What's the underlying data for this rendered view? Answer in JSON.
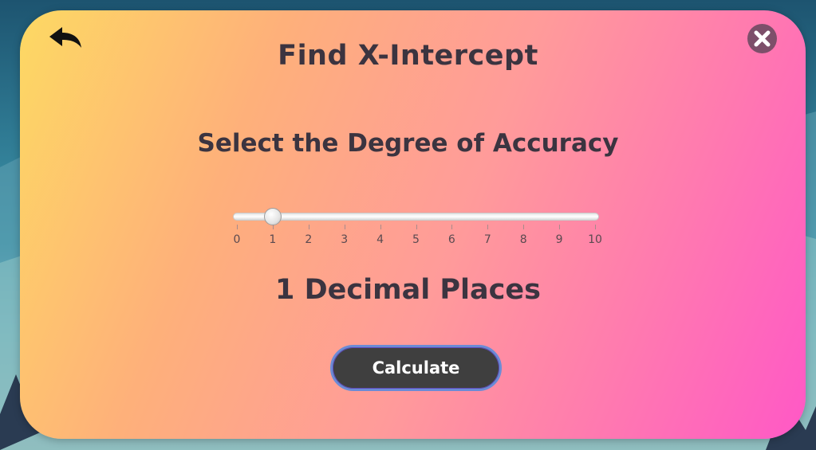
{
  "dialog": {
    "title": "Find X-Intercept",
    "subtitle": "Select the Degree of Accuracy",
    "value_text": "1 Decimal Places",
    "calculate_label": "Calculate"
  },
  "slider": {
    "min": 0,
    "max": 10,
    "value": 1,
    "tick_labels": [
      "0",
      "1",
      "2",
      "3",
      "4",
      "5",
      "6",
      "7",
      "8",
      "9",
      "10"
    ]
  },
  "icons": {
    "back": "back-arrow-icon",
    "close": "close-icon"
  },
  "colors": {
    "panel_gradient_start": "#fdd963",
    "panel_gradient_end": "#ff58c6",
    "text_dark": "#3b3440",
    "button_bg": "#3f3f3f",
    "close_bg": "#7d4f6a"
  }
}
